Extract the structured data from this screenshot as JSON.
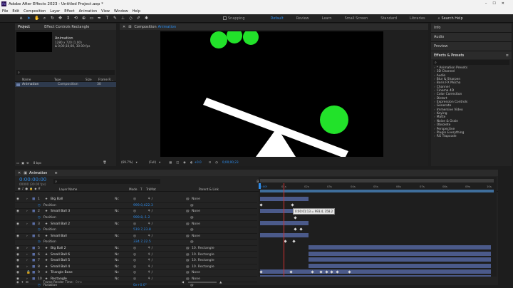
{
  "app": {
    "title": "Adobe After Effects 2023 - Untitled Project.aep *",
    "menu": [
      "File",
      "Edit",
      "Composition",
      "Layer",
      "Effect",
      "Animation",
      "View",
      "Window",
      "Help"
    ]
  },
  "toolbar": {
    "snapping_label": "Snapping",
    "workspaces": [
      "Default",
      "Review",
      "Learn",
      "Small Screen",
      "Standard",
      "Libraries"
    ],
    "active_workspace": "Default",
    "search_label": "Search Help"
  },
  "project_panel": {
    "tab_project": "Project",
    "tab_effect_controls": "Effect Controls Rectangle",
    "item_name": "Animation",
    "item_info_1": "1280 x 720 (1.00)",
    "item_info_2": "Δ 0;00;10;00, 30.00 fps",
    "search_placeholder": "",
    "columns": [
      "Name",
      "Type",
      "Size",
      "Frame R..."
    ],
    "rows": [
      {
        "name": "Animation",
        "type": "Composition",
        "size": "",
        "frame_rate": "30"
      }
    ],
    "bpc": "8 bpc"
  },
  "comp_panel": {
    "tab_label": "Composition",
    "tab_comp_name": "Animation",
    "zoom": "(69.7%)",
    "resolution": "(Full)",
    "exposure": "+0.0",
    "timecode": "0;00;00;23"
  },
  "right_panel": {
    "tabs": [
      "Info",
      "Audio",
      "Preview"
    ],
    "effects_title": "Effects & Presets",
    "search_placeholder": "",
    "categories": [
      "* Animation Presets",
      "3D Channel",
      "Audio",
      "Blur & Sharpen",
      "Boris FX Mocha",
      "Channel",
      "Cinema 4D",
      "Color Correction",
      "Distort",
      "Expression Controls",
      "Generate",
      "Immersive Video",
      "Keying",
      "Matte",
      "Noise & Grain",
      "Obsolete",
      "Perspective",
      "Plugin Everything",
      "RG Trapcode"
    ]
  },
  "timeline": {
    "tab_label": "Animation",
    "timecode": "0:00:00:00",
    "timecode_sub": "00000 (30.00 fps)",
    "columns": [
      "Layer Name",
      "Mode",
      "T",
      "TrkMat",
      "Parent & Link"
    ],
    "rows": [
      {
        "num": "1",
        "name": "Big Ball",
        "mode": "Nc",
        "value": "",
        "parent": "None",
        "kind": "layer"
      },
      {
        "num": "",
        "name": "Position",
        "mode": "",
        "value": "999.0,422.3",
        "parent": "",
        "kind": "prop"
      },
      {
        "num": "2",
        "name": "Small Ball 3",
        "mode": "Nc",
        "value": "",
        "parent": "None",
        "kind": "layer"
      },
      {
        "num": "",
        "name": "Position",
        "mode": "",
        "value": "999.8,-1.2",
        "parent": "",
        "kind": "prop"
      },
      {
        "num": "3",
        "name": "Small Ball 2",
        "mode": "Nc",
        "value": "",
        "parent": "None",
        "kind": "layer"
      },
      {
        "num": "",
        "name": "Position",
        "mode": "",
        "value": "519.7,23.8",
        "parent": "",
        "kind": "prop"
      },
      {
        "num": "4",
        "name": "Small Ball",
        "mode": "Nc",
        "value": "",
        "parent": "None",
        "kind": "layer"
      },
      {
        "num": "",
        "name": "Position",
        "mode": "",
        "value": "334.7,22.5",
        "parent": "",
        "kind": "prop"
      },
      {
        "num": "5",
        "name": "Big Ball 2",
        "mode": "Nc",
        "value": "",
        "parent": "10. Rectangle",
        "kind": "layer"
      },
      {
        "num": "6",
        "name": "Small Ball 6",
        "mode": "Nc",
        "value": "",
        "parent": "10. Rectangle",
        "kind": "layer"
      },
      {
        "num": "7",
        "name": "Small Ball 5",
        "mode": "Nc",
        "value": "",
        "parent": "10. Rectangle",
        "kind": "layer"
      },
      {
        "num": "8",
        "name": "Small Ball 4",
        "mode": "Nc",
        "value": "",
        "parent": "10. Rectangle",
        "kind": "layer"
      },
      {
        "num": "9",
        "name": "Triangle Base",
        "mode": "Nc",
        "value": "",
        "parent": "None",
        "kind": "layer"
      },
      {
        "num": "10",
        "name": "Rectangle",
        "mode": "Nc",
        "value": "",
        "parent": "None",
        "kind": "layer"
      },
      {
        "num": "",
        "name": "Rotation",
        "mode": "",
        "value": "0x+0.0°",
        "parent": "",
        "kind": "prop"
      }
    ],
    "ruler_labels": [
      "0:00f",
      "01s",
      "02s",
      "03s",
      "04s",
      "05s",
      "06s",
      "07s",
      "08s",
      "09s",
      "10s"
    ],
    "tooltip": "0:00:01:13 = 993.4, 358.2",
    "footer": "Frame Render Time:",
    "footer_value": "0ms"
  },
  "colors": {
    "accent": "#2d8ceb",
    "ball": "#22e22a",
    "bar": "#4b5a8a",
    "playhead": "#d03030"
  }
}
